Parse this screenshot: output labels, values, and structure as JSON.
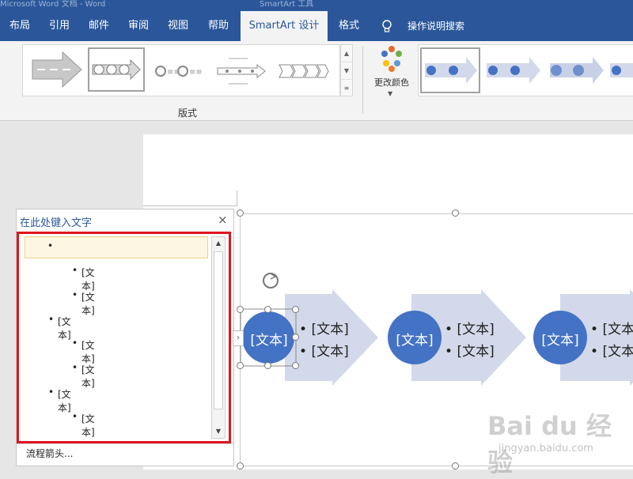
{
  "window": {
    "title_left": "Microsoft Word 文档 - Word",
    "title_right": "SmartArt 工具"
  },
  "ribbon": {
    "tabs": [
      {
        "label": "布局"
      },
      {
        "label": "引用"
      },
      {
        "label": "邮件"
      },
      {
        "label": "审阅"
      },
      {
        "label": "视图"
      },
      {
        "label": "帮助"
      },
      {
        "label": "SmartArt 设计",
        "active": true
      },
      {
        "label": "格式"
      }
    ],
    "tell_me": "操作说明搜索",
    "layouts_group_label": "版式",
    "change_colors_label": "更改颜色"
  },
  "text_pane": {
    "title": "在此处键入文字",
    "close_symbol": "×",
    "items": [
      {
        "level": 1,
        "text": ""
      },
      {
        "level": 2,
        "text": "[文本]"
      },
      {
        "level": 2,
        "text": "[文本]"
      },
      {
        "level": 1,
        "text": "[文本]"
      },
      {
        "level": 2,
        "text": "[文本]"
      },
      {
        "level": 2,
        "text": "[文本]"
      },
      {
        "level": 1,
        "text": "[文本]"
      },
      {
        "level": 2,
        "text": "[文本]"
      }
    ],
    "footer": "流程箭头..."
  },
  "smartart": {
    "circle_texts": [
      "[文本]",
      "[文本]",
      "[文本]"
    ],
    "bullet_text": "[文本]"
  },
  "colors": {
    "ribbon_blue": "#2b579a",
    "circle_blue": "#4472c4",
    "arrow_fill": "#d3d9ea",
    "highlight_red": "#e0141e"
  },
  "watermark": {
    "brand": "Bai du 经验",
    "url": "jingyan.baidu.com"
  }
}
